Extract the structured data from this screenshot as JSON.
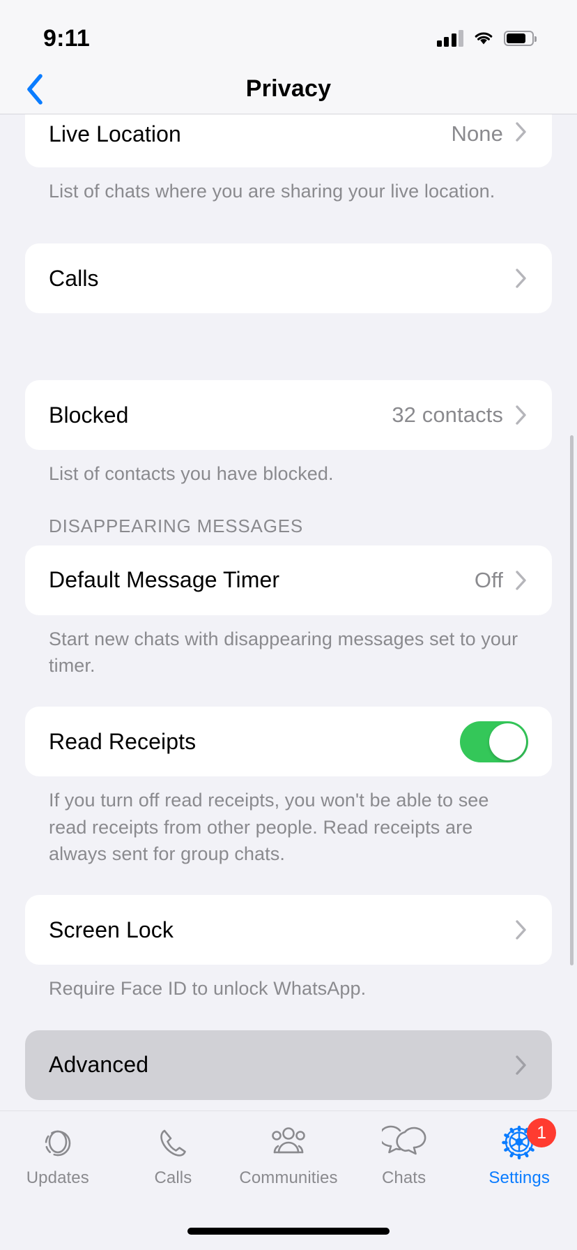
{
  "status_bar": {
    "time": "9:11",
    "signal_icon": "cellular-signal-icon",
    "wifi_icon": "wifi-icon",
    "battery_icon": "battery-icon"
  },
  "nav": {
    "title": "Privacy",
    "back_icon": "chevron-left-icon"
  },
  "colors": {
    "accent_blue": "#0A7CFF",
    "toggle_on_green": "#34C759",
    "badge_red": "#FF3B30",
    "page_background": "#F2F2F7",
    "card_background": "#FFFFFF",
    "pressed_row": "#D1D1D6",
    "secondary_text": "#8A8A8E"
  },
  "sections": [
    {
      "id": "live-location",
      "rows": [
        {
          "label": "Live Location",
          "value": "None",
          "accessory": "chevron-right-icon"
        }
      ],
      "footer": "List of chats where you are sharing your live location."
    },
    {
      "id": "calls",
      "rows": [
        {
          "label": "Calls",
          "value": "",
          "accessory": "chevron-right-icon"
        }
      ],
      "footer": ""
    },
    {
      "id": "blocked",
      "rows": [
        {
          "label": "Blocked",
          "value": "32 contacts",
          "accessory": "chevron-right-icon"
        }
      ],
      "footer": "List of contacts you have blocked."
    },
    {
      "id": "disappearing-messages",
      "header": "DISAPPEARING MESSAGES",
      "rows": [
        {
          "label": "Default Message Timer",
          "value": "Off",
          "accessory": "chevron-right-icon"
        }
      ],
      "footer": "Start new chats with disappearing messages set to your timer."
    },
    {
      "id": "read-receipts",
      "rows": [
        {
          "label": "Read Receipts",
          "value": "",
          "accessory": "toggle-switch",
          "toggle_state": "on"
        }
      ],
      "footer": "If you turn off read receipts, you won't be able to see read receipts from other people. Read receipts are always sent for group chats."
    },
    {
      "id": "screen-lock",
      "rows": [
        {
          "label": "Screen Lock",
          "value": "",
          "accessory": "chevron-right-icon"
        }
      ],
      "footer": "Require Face ID to unlock WhatsApp."
    },
    {
      "id": "advanced",
      "pressed": true,
      "rows": [
        {
          "label": "Advanced",
          "value": "",
          "accessory": "chevron-right-icon"
        }
      ],
      "footer": ""
    }
  ],
  "tab_bar": {
    "tabs": [
      {
        "label": "Updates",
        "icon": "updates-status-icon",
        "active": false,
        "badge": ""
      },
      {
        "label": "Calls",
        "icon": "phone-icon",
        "active": false,
        "badge": ""
      },
      {
        "label": "Communities",
        "icon": "communities-people-icon",
        "active": false,
        "badge": ""
      },
      {
        "label": "Chats",
        "icon": "chat-bubbles-icon",
        "active": false,
        "badge": ""
      },
      {
        "label": "Settings",
        "icon": "gear-icon",
        "active": true,
        "badge": "1"
      }
    ]
  },
  "home_indicator": "home-indicator"
}
